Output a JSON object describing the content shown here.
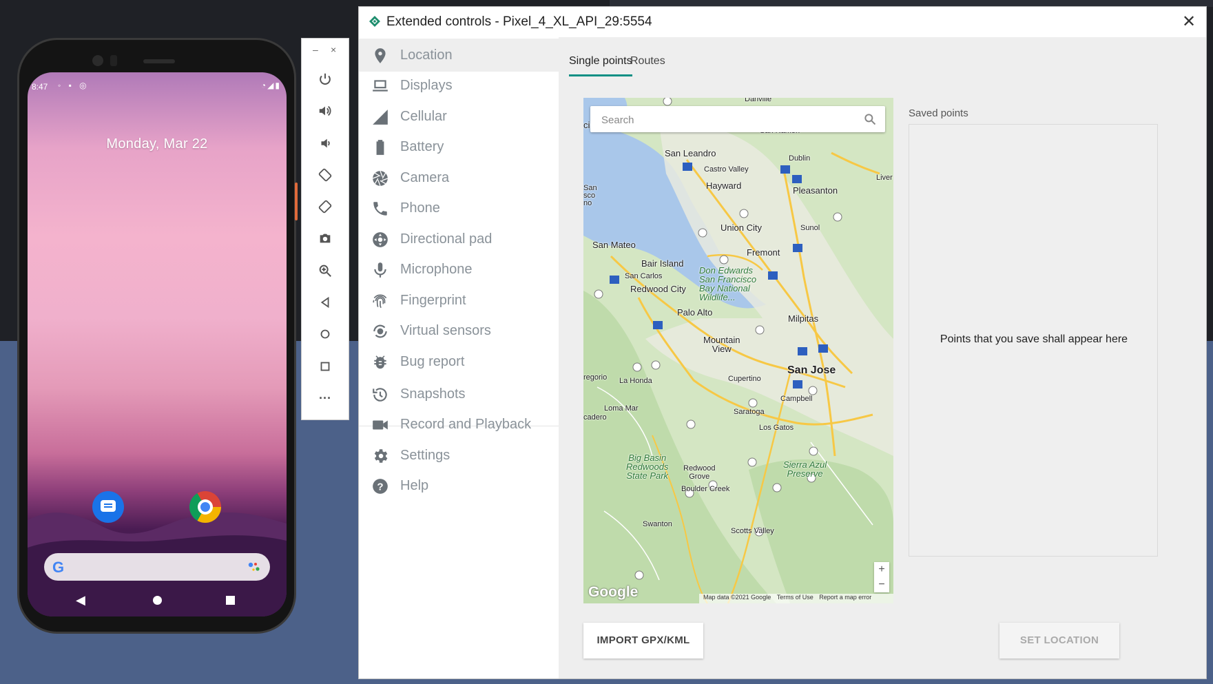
{
  "phone": {
    "time": "8:47",
    "date": "Monday, Mar 22",
    "search_logo": "G"
  },
  "emulator_toolbar": {
    "minimize": "–",
    "close": "×",
    "tools": [
      "power-icon",
      "volume-up-icon",
      "volume-down-icon",
      "rotate-left-icon",
      "rotate-right-icon",
      "camera-icon",
      "zoom-icon",
      "back-icon",
      "home-icon",
      "overview-icon",
      "more-icon"
    ],
    "more_label": "···"
  },
  "window": {
    "title": "Extended controls - Pixel_4_XL_API_29:5554",
    "close": "✕"
  },
  "sidebar": {
    "items": [
      {
        "label": "Location",
        "icon": "location-pin-icon"
      },
      {
        "label": "Displays",
        "icon": "display-icon"
      },
      {
        "label": "Cellular",
        "icon": "cellular-icon"
      },
      {
        "label": "Battery",
        "icon": "battery-icon"
      },
      {
        "label": "Camera",
        "icon": "camera-aperture-icon"
      },
      {
        "label": "Phone",
        "icon": "phone-icon"
      },
      {
        "label": "Directional pad",
        "icon": "dpad-icon"
      },
      {
        "label": "Microphone",
        "icon": "microphone-icon"
      },
      {
        "label": "Fingerprint",
        "icon": "fingerprint-icon"
      },
      {
        "label": "Virtual sensors",
        "icon": "sensors-icon"
      },
      {
        "label": "Bug report",
        "icon": "bug-icon"
      },
      {
        "label": "Snapshots",
        "icon": "history-icon"
      },
      {
        "label": "Record and Playback",
        "icon": "video-camera-icon"
      },
      {
        "label": "Settings",
        "icon": "gear-icon"
      },
      {
        "label": "Help",
        "icon": "help-icon"
      }
    ],
    "active": "Location"
  },
  "tabs": {
    "single": "Single points",
    "routes": "Routes"
  },
  "map": {
    "search_placeholder": "Search",
    "zoom_in": "+",
    "zoom_out": "−",
    "logo": "Google",
    "attribution": "Map data ©2021 Google",
    "terms": "Terms of Use",
    "report": "Report a map error",
    "labels": {
      "danville": "Danville",
      "san_ramon": "San Ramon",
      "san_leandro": "San Leandro",
      "dublin": "Dublin",
      "castro_valley": "Castro Valley",
      "livermore": "Liver",
      "hayward": "Hayward",
      "pleasanton": "Pleasanton",
      "san_fran_edge": "San\nsco\nno",
      "union_city": "Union City",
      "sunol": "Sunol",
      "san_mateo": "San Mateo",
      "fremont": "Fremont",
      "bair_island": "Bair Island",
      "san_carlos": "San Carlos",
      "don_edwards": "Don Edwards\nSan Francisco\nBay National\nWildlife...",
      "redwood_city": "Redwood City",
      "palo_alto": "Palo Alto",
      "milpitas": "Milpitas",
      "mountain_view": "Mountain\nView",
      "san_jose": "San Jose",
      "gregorio": "regorio",
      "la_honda": "La Honda",
      "cupertino": "Cupertino",
      "campbell": "Campbell",
      "loma_mar": "Loma Mar",
      "saratoga": "Saratoga",
      "cadero": "cadero",
      "los_gatos": "Los Gatos",
      "big_basin": "Big Basin\nRedwoods\nState Park",
      "redwood_grove": "Redwood\nGrove",
      "sierra_azul": "Sierra Azul\nPreserve",
      "boulder_creek": "Boulder Creek",
      "swanton": "Swanton",
      "scotts_valley": "Scotts Valley",
      "cis": "cis"
    }
  },
  "saved": {
    "label": "Saved points",
    "empty": "Points that you save shall appear here"
  },
  "buttons": {
    "import": "IMPORT GPX/KML",
    "set_location": "SET LOCATION"
  },
  "colors": {
    "accent": "#0d8f84",
    "desktop_blue": "#4c6189",
    "desktop_dark": "#1f2126",
    "water": "#a9c7ea",
    "land": "#d4e6c3"
  }
}
